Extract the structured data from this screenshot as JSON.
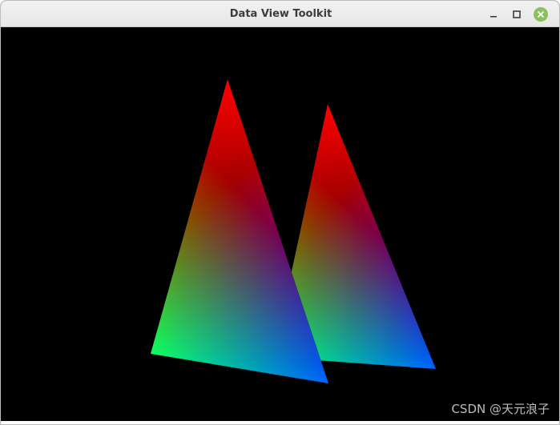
{
  "window": {
    "title": "Data View Toolkit"
  },
  "titlebar_controls": {
    "minimize_icon": "minimize-icon",
    "maximize_icon": "maximize-icon",
    "close_icon": "close-icon",
    "close_color": "#8cbf5f"
  },
  "scene": {
    "background": "#000000",
    "triangles": [
      {
        "name": "back-triangle",
        "vertex_colors": [
          "#ff0000",
          "#00ff00",
          "#0000ff"
        ]
      },
      {
        "name": "front-triangle",
        "vertex_colors": [
          "#ff0000",
          "#00ff00",
          "#0000ff"
        ]
      }
    ]
  },
  "watermark": {
    "text": "CSDN @天元浪子"
  }
}
